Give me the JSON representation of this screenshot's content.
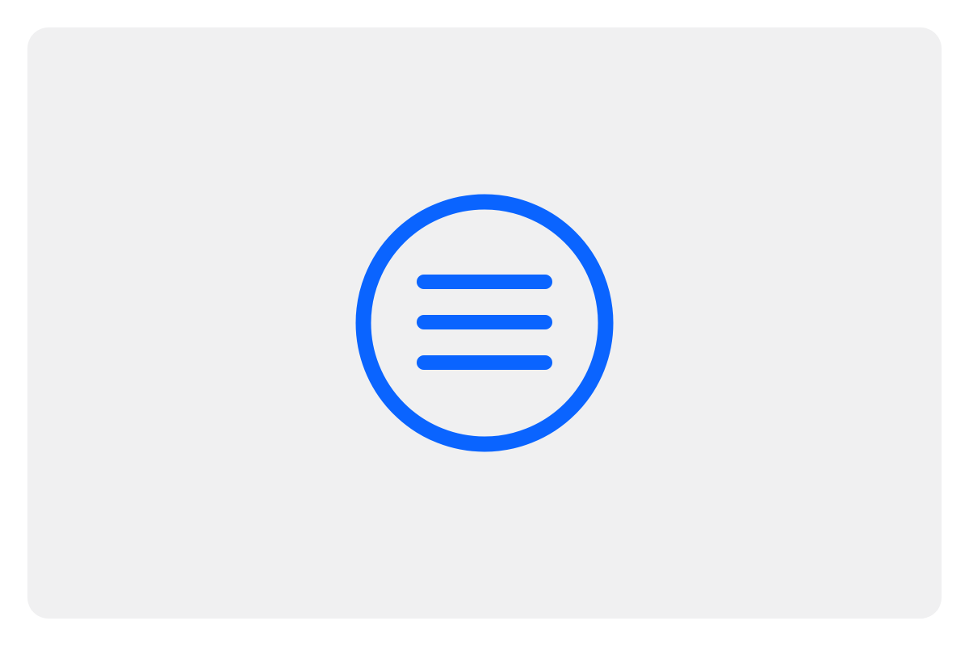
{
  "colors": {
    "page_background": "#ffffff",
    "card_background": "#f0f0f1",
    "accent": "#0a64ff"
  },
  "icon": {
    "name": "menu-icon",
    "style": "hamburger menu inside circle outline"
  }
}
